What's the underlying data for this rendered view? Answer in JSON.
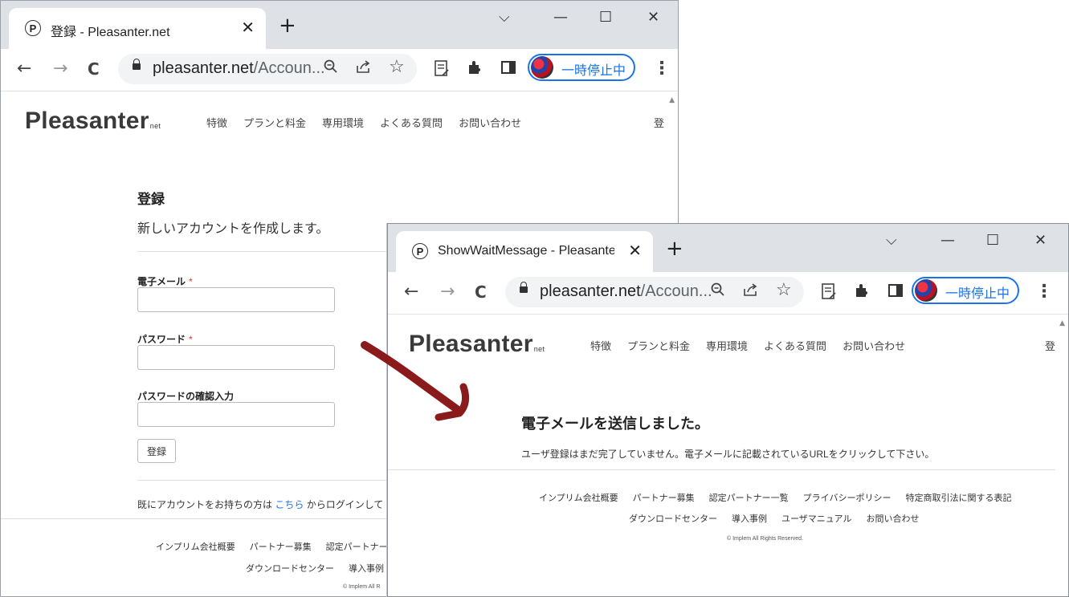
{
  "window1": {
    "tab_title": "登録 - Pleasanter.net",
    "favicon_letter": "P",
    "tab_close": "✕",
    "new_tab": "+",
    "controls": {
      "dropdown": "⌵",
      "minimize": "—",
      "maximize": "☐",
      "close": "✕"
    },
    "url_domain": "pleasanter.net",
    "url_rest": "/Accoun...",
    "profile_label": "一時停止中",
    "site": {
      "logo": "Pleasanter",
      "logo_suffix": "net",
      "nav": [
        "特徴",
        "プランと料金",
        "専用環境",
        "よくある質問",
        "お問い合わせ"
      ],
      "nav_login": "登",
      "heading": "登録",
      "subheading": "新しいアカウントを作成します。",
      "email_label": "電子メール",
      "password_label": "パスワード",
      "confirm_label": "パスワードの確認入力",
      "required_mark": "*",
      "register_button": "登録",
      "already_prefix": "既にアカウントをお持ちの方は ",
      "already_link": "こちら",
      "already_suffix": " からログインして",
      "footer_row1": [
        "インプリム会社概要",
        "パートナー募集",
        "認定パートナー"
      ],
      "footer_row2": [
        "ダウンロードセンター",
        "導入事例"
      ],
      "copyright": "© Implem All R"
    }
  },
  "window2": {
    "tab_title": "ShowWaitMessage - Pleasanter.n",
    "favicon_letter": "P",
    "tab_close": "✕",
    "new_tab": "+",
    "controls": {
      "dropdown": "⌵",
      "minimize": "—",
      "maximize": "☐",
      "close": "✕"
    },
    "url_domain": "pleasanter.net",
    "url_rest": "/Accoun...",
    "profile_label": "一時停止中",
    "site": {
      "logo": "Pleasanter",
      "logo_suffix": "net",
      "nav": [
        "特徴",
        "プランと料金",
        "専用環境",
        "よくある質問",
        "お問い合わせ"
      ],
      "nav_login": "登",
      "heading": "電子メールを送信しました。",
      "message": "ユーザ登録はまだ完了していません。電子メールに記載されているURLをクリックして下さい。",
      "footer_row1": [
        "インプリム会社概要",
        "パートナー募集",
        "認定パートナー一覧",
        "プライバシーポリシー",
        "特定商取引法に関する表記"
      ],
      "footer_row2": [
        "ダウンロードセンター",
        "導入事例",
        "ユーザマニュアル",
        "お問い合わせ"
      ],
      "copyright": "© Implem All Rights Reserved."
    }
  },
  "toolbar_icons": {
    "back": "←",
    "forward": "→",
    "reload": "C",
    "zoom": "🔍",
    "share": "⇪",
    "bookmark": "☆",
    "notes": "📄",
    "extensions": "✱",
    "sidepanel": "◨",
    "menu": "⋮"
  },
  "annotation": {
    "arrow_color": "#8b1a1a"
  }
}
